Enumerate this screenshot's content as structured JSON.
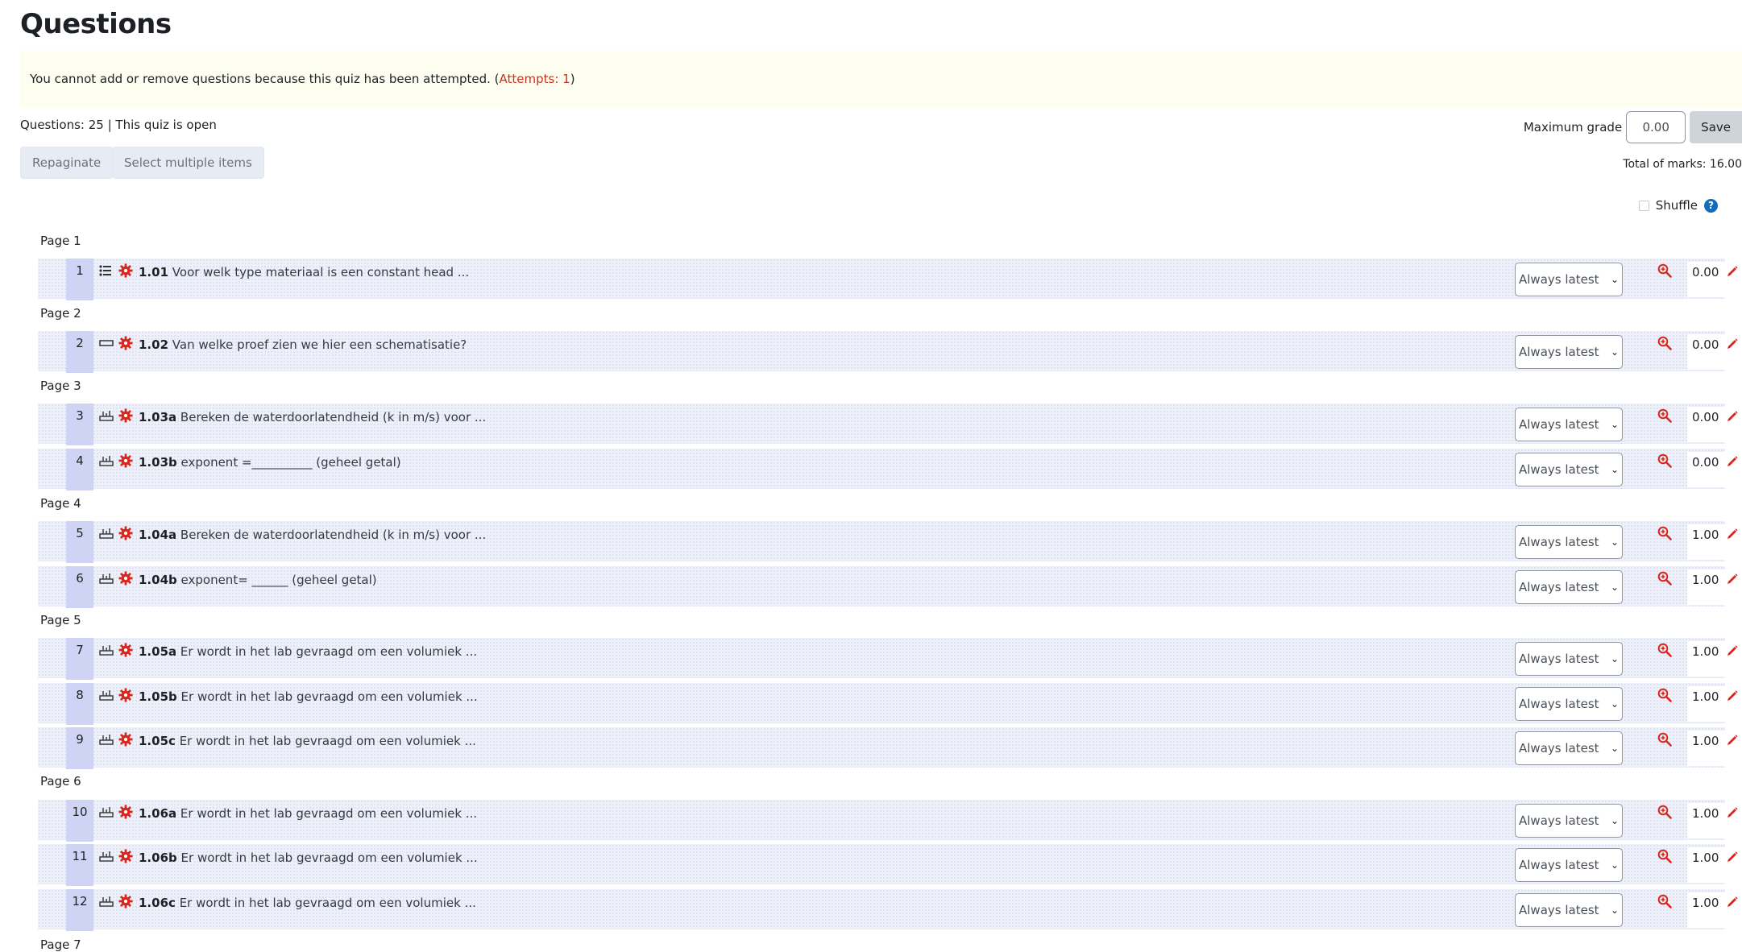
{
  "page": {
    "title": "Questions"
  },
  "alert": {
    "text": "You cannot add or remove questions because this quiz has been attempted. (",
    "attempts_link": "Attempts: 1",
    "close": ")"
  },
  "info": {
    "summary": "Questions: 25 | This quiz is open"
  },
  "toolbar": {
    "repaginate": "Repaginate",
    "select_multiple": "Select multiple items"
  },
  "grade": {
    "label": "Maximum grade",
    "value": "0.00",
    "save": "Save",
    "total": "Total of marks: 16.00"
  },
  "shuffle": {
    "label": "Shuffle",
    "help": "?"
  },
  "pages": [
    {
      "label": "Page 1"
    },
    {
      "label": "Page 2"
    },
    {
      "label": "Page 3"
    },
    {
      "label": "Page 4"
    },
    {
      "label": "Page 5"
    },
    {
      "label": "Page 6"
    },
    {
      "label": "Page 7"
    }
  ],
  "version_option": "Always latest",
  "colors": {
    "accent_red": "#d9261c",
    "link_red": "#ca3120",
    "help_blue": "#0f6cbf",
    "row_bg": "#eef0fa",
    "num_bg": "#cfd4f4"
  },
  "questions": [
    {
      "num": "1",
      "type_icon": "multichoice-icon",
      "code": "1.01",
      "text": "Voor welk type materiaal is een constant head ...",
      "mark": "0.00"
    },
    {
      "num": "2",
      "type_icon": "shortanswer-icon",
      "code": "1.02",
      "text": "Van welke proef zien we hier een schematisatie?",
      "mark": "0.00"
    },
    {
      "num": "3",
      "type_icon": "calculated-icon",
      "code": "1.03a",
      "text": "Bereken de waterdoorlatendheid (k in m/s) voor ...",
      "mark": "0.00"
    },
    {
      "num": "4",
      "type_icon": "calculated-icon",
      "code": "1.03b",
      "text": "exponent =__________ (geheel getal)",
      "mark": "0.00"
    },
    {
      "num": "5",
      "type_icon": "calculated-icon",
      "code": "1.04a",
      "text": "Bereken de waterdoorlatendheid (k in m/s) voor ...",
      "mark": "1.00"
    },
    {
      "num": "6",
      "type_icon": "calculated-icon",
      "code": "1.04b",
      "text": "exponent= ______ (geheel getal)",
      "mark": "1.00"
    },
    {
      "num": "7",
      "type_icon": "calculated-icon",
      "code": "1.05a",
      "text": "Er wordt in het lab gevraagd om een volumiek ...",
      "mark": "1.00"
    },
    {
      "num": "8",
      "type_icon": "calculated-icon",
      "code": "1.05b",
      "text": "Er wordt in het lab gevraagd om een volumiek ...",
      "mark": "1.00"
    },
    {
      "num": "9",
      "type_icon": "calculated-icon",
      "code": "1.05c",
      "text": "Er wordt in het lab gevraagd om een volumiek ...",
      "mark": "1.00"
    },
    {
      "num": "10",
      "type_icon": "calculated-icon",
      "code": "1.06a",
      "text": "Er wordt in het lab gevraagd om een volumiek ...",
      "mark": "1.00"
    },
    {
      "num": "11",
      "type_icon": "calculated-icon",
      "code": "1.06b",
      "text": "Er wordt in het lab gevraagd om een volumiek ...",
      "mark": "1.00"
    },
    {
      "num": "12",
      "type_icon": "calculated-icon",
      "code": "1.06c",
      "text": "Er wordt in het lab gevraagd om een volumiek ...",
      "mark": "1.00"
    }
  ]
}
